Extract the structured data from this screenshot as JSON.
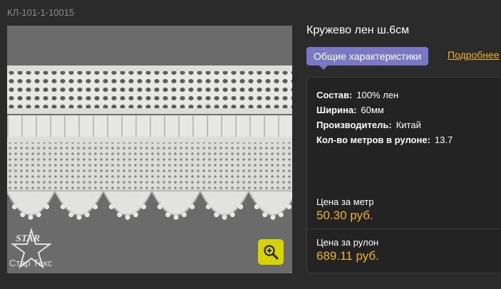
{
  "sku": "КЛ-101-1-10015",
  "product": {
    "title": "Кружево лен ш.6см",
    "image_alt": "Кружево лен",
    "watermark": "Стар Текс"
  },
  "tabs": [
    {
      "label": "Общие характеристики",
      "active": true
    },
    {
      "label": "Подробнее",
      "active": false
    }
  ],
  "specs": [
    {
      "label": "Состав:",
      "value": "100% лен"
    },
    {
      "label": "Ширина:",
      "value": "60мм"
    },
    {
      "label": "Производитель:",
      "value": "Китай"
    },
    {
      "label": "Кол-во метров в рулоне:",
      "value": "13.7"
    }
  ],
  "prices": [
    {
      "label": "Цена за метр",
      "value": "50.30 руб."
    },
    {
      "label": "Цена за рулон",
      "value": "689.11 руб."
    }
  ],
  "colors": {
    "accent": "#f3b21a",
    "tab": "#7878c6",
    "zoom": "#d7d300",
    "background": "#2b2b2b"
  },
  "icons": {
    "zoom": "zoom-in-icon",
    "watermark": "star-logo-icon"
  }
}
